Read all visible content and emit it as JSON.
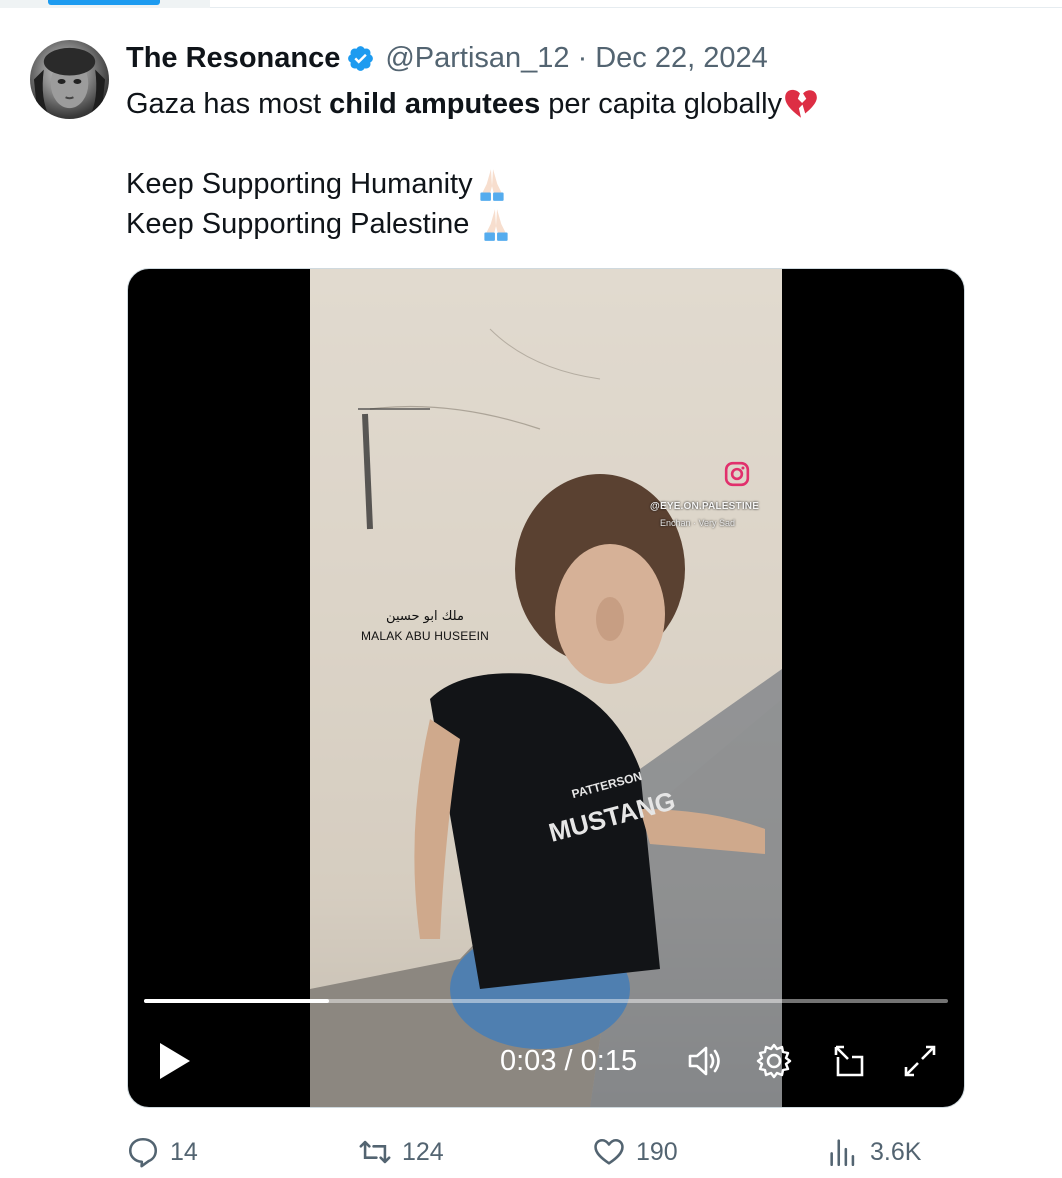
{
  "tweet": {
    "display_name": "The Resonance",
    "handle": "@Partisan_12",
    "separator": "·",
    "date": "Dec 22, 2024",
    "text": {
      "line1_before": "Gaza has most ",
      "line1_bold": "child amputees",
      "line1_after": " per capita globally",
      "line1_emoji": "broken-heart",
      "line2": "Keep Supporting Humanity",
      "line2_emoji": "folded-hands",
      "line3": "Keep Supporting Palestine ",
      "line3_emoji": "folded-hands"
    }
  },
  "video": {
    "overlay": {
      "instagram_handle": "@EYE.ON.PALESTINE",
      "song": "Enchan · Very Sad",
      "name_arabic": "ملك ابو حسين",
      "name_latin": "MALAK ABU HUSEEIN"
    },
    "time_current": "0:03",
    "time_sep": " / ",
    "time_total": "0:15",
    "progress_fraction": 0.23,
    "controls": [
      "play-icon",
      "volume-icon",
      "settings-gear-icon",
      "pop-out-icon",
      "fullscreen-icon"
    ]
  },
  "actions": {
    "replies": "14",
    "reposts": "124",
    "likes": "190",
    "views": "3.6K"
  },
  "colors": {
    "verified_blue": "#1d9bf0",
    "secondary_text": "#536471",
    "primary_text": "#0f1419",
    "broken_heart": "#e0245e"
  }
}
